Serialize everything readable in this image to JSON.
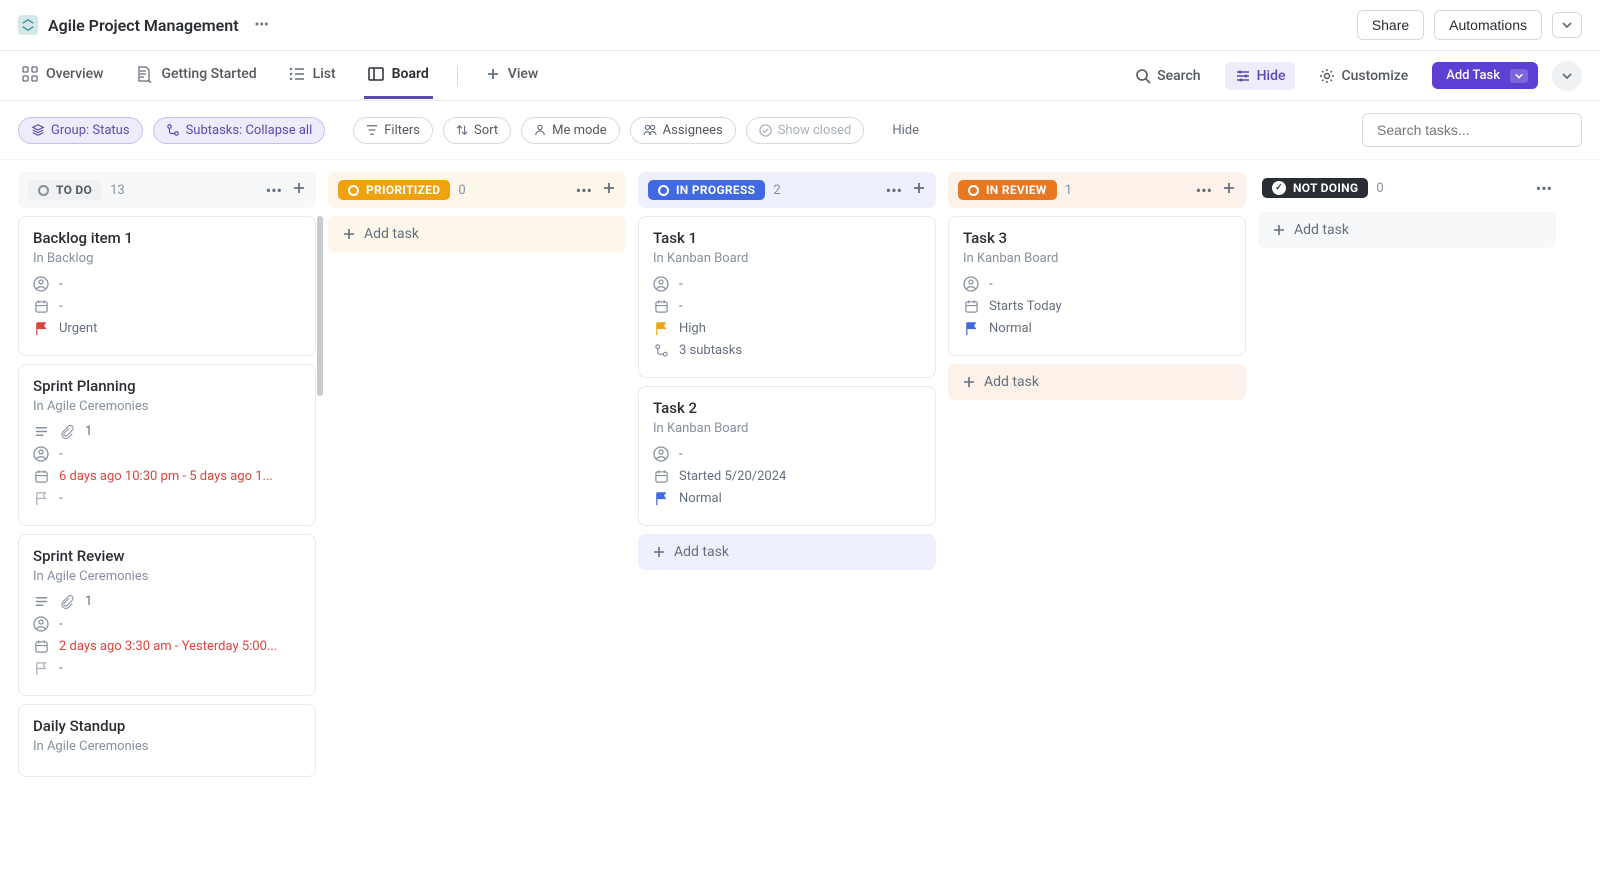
{
  "header": {
    "title": "Agile Project Management",
    "share": "Share",
    "automations": "Automations"
  },
  "tabs": {
    "overview": "Overview",
    "getting_started": "Getting Started",
    "list": "List",
    "board": "Board",
    "view": "View"
  },
  "nav_right": {
    "search": "Search",
    "hide": "Hide",
    "customize": "Customize",
    "add_task": "Add Task"
  },
  "filters": {
    "group": "Group: Status",
    "subtasks": "Subtasks: Collapse all",
    "filters": "Filters",
    "sort": "Sort",
    "me_mode": "Me mode",
    "assignees": "Assignees",
    "show_closed": "Show closed",
    "hide": "Hide",
    "search_placeholder": "Search tasks..."
  },
  "add_task_label": "Add task",
  "columns": [
    {
      "key": "todo",
      "label": "TO DO",
      "count": "13",
      "pill_class": "todo",
      "head_bg": "bg-gray",
      "show_add_task": false,
      "has_scroll": true,
      "cards": [
        {
          "title": "Backlog item 1",
          "sub": "In Backlog",
          "rows": [
            {
              "type": "assignee",
              "text": "-"
            },
            {
              "type": "date",
              "text": "-"
            },
            {
              "type": "flag",
              "text": "Urgent",
              "flag": "urgent"
            }
          ]
        },
        {
          "title": "Sprint Planning",
          "sub": "In Agile Ceremonies",
          "rows": [
            {
              "type": "desc_attach",
              "text": "1"
            },
            {
              "type": "assignee",
              "text": "-"
            },
            {
              "type": "date",
              "text": "6 days ago 10:30 pm - 5 days ago 1...",
              "overdue": true
            },
            {
              "type": "flag",
              "text": "-",
              "flag": "none"
            }
          ]
        },
        {
          "title": "Sprint Review",
          "sub": "In Agile Ceremonies",
          "rows": [
            {
              "type": "desc_attach",
              "text": "1"
            },
            {
              "type": "assignee",
              "text": "-"
            },
            {
              "type": "date",
              "text": "2 days ago 3:30 am - Yesterday 5:00...",
              "overdue": true
            },
            {
              "type": "flag",
              "text": "-",
              "flag": "none"
            }
          ]
        },
        {
          "title": "Daily Standup",
          "sub": "In Agile Ceremonies",
          "rows": []
        }
      ]
    },
    {
      "key": "prioritized",
      "label": "PRIORITIZED",
      "count": "0",
      "pill_class": "prio",
      "head_bg": "bg-yellow",
      "show_add_task": true,
      "add_bg": "bg-yellow",
      "cards": []
    },
    {
      "key": "in_progress",
      "label": "IN PROGRESS",
      "count": "2",
      "pill_class": "prog",
      "head_bg": "bg-blue",
      "show_add_task": true,
      "add_bg": "bg-blue",
      "cards": [
        {
          "title": "Task 1",
          "sub": "In Kanban Board",
          "rows": [
            {
              "type": "assignee",
              "text": "-"
            },
            {
              "type": "date",
              "text": "-"
            },
            {
              "type": "flag",
              "text": "High",
              "flag": "high"
            },
            {
              "type": "subtasks",
              "text": "3 subtasks"
            }
          ]
        },
        {
          "title": "Task 2",
          "sub": "In Kanban Board",
          "rows": [
            {
              "type": "assignee",
              "text": "-"
            },
            {
              "type": "date",
              "text": "Started 5/20/2024"
            },
            {
              "type": "flag",
              "text": "Normal",
              "flag": "normal"
            }
          ]
        }
      ]
    },
    {
      "key": "in_review",
      "label": "IN REVIEW",
      "count": "1",
      "pill_class": "rev",
      "head_bg": "bg-orange",
      "show_add_task": true,
      "add_bg": "bg-orange",
      "cards": [
        {
          "title": "Task 3",
          "sub": "In Kanban Board",
          "rows": [
            {
              "type": "assignee",
              "text": "-"
            },
            {
              "type": "date",
              "text": "Starts Today"
            },
            {
              "type": "flag",
              "text": "Normal",
              "flag": "normal"
            }
          ]
        }
      ]
    },
    {
      "key": "not_doing",
      "label": "NOT DOING",
      "count": "0",
      "pill_class": "notdo",
      "head_bg": "",
      "head_actions_dots_only": true,
      "show_add_task": true,
      "add_bg": "bg-gray",
      "cards": []
    }
  ]
}
